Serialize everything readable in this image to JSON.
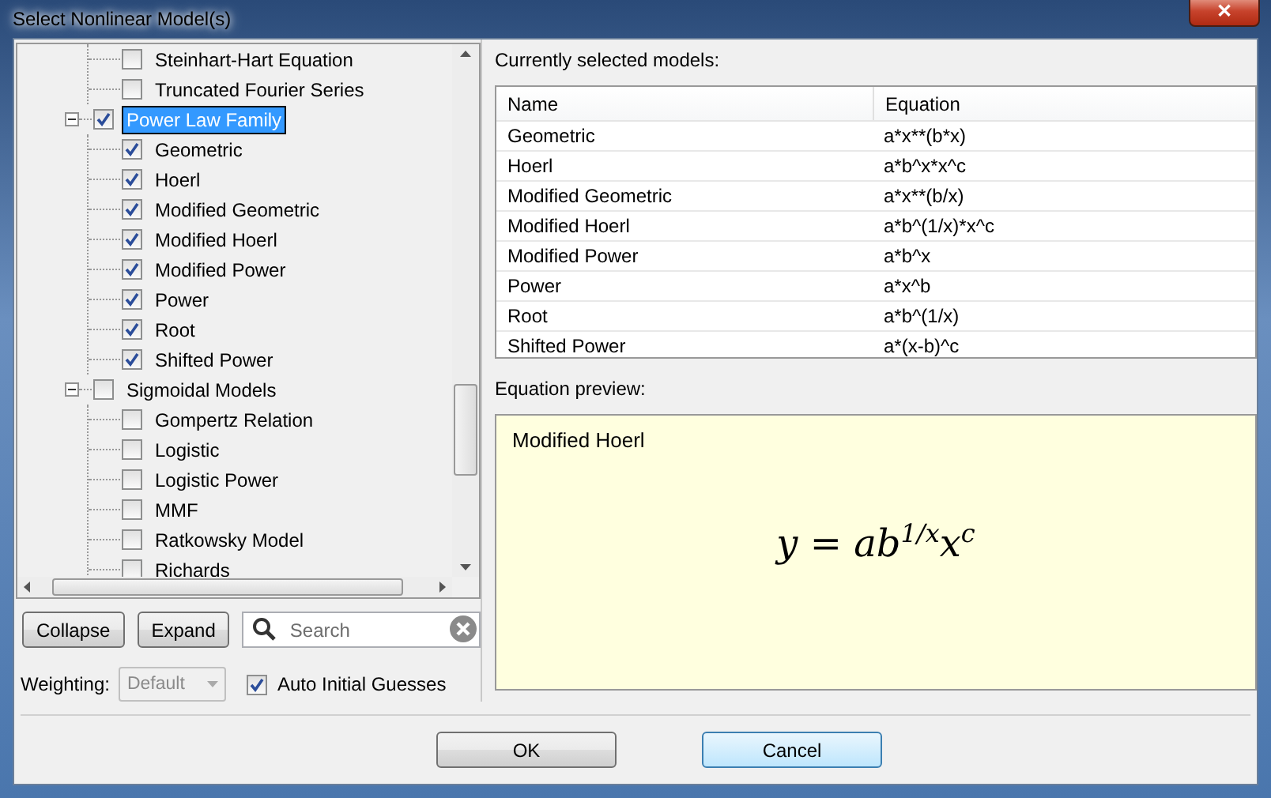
{
  "window": {
    "title": "Select Nonlinear Model(s)",
    "close_label": "✕"
  },
  "tree": {
    "leading_items": [
      {
        "label": "Steinhart-Hart Equation",
        "checked": false
      },
      {
        "label": "Truncated Fourier Series",
        "checked": false
      }
    ],
    "groups": [
      {
        "label": "Power Law Family",
        "checked": true,
        "expanded": true,
        "selected": true,
        "children": [
          {
            "label": "Geometric",
            "checked": true
          },
          {
            "label": "Hoerl",
            "checked": true
          },
          {
            "label": "Modified Geometric",
            "checked": true
          },
          {
            "label": "Modified Hoerl",
            "checked": true
          },
          {
            "label": "Modified Power",
            "checked": true
          },
          {
            "label": "Power",
            "checked": true
          },
          {
            "label": "Root",
            "checked": true
          },
          {
            "label": "Shifted Power",
            "checked": true
          }
        ]
      },
      {
        "label": "Sigmoidal Models",
        "checked": false,
        "expanded": true,
        "selected": false,
        "children": [
          {
            "label": "Gompertz Relation",
            "checked": false
          },
          {
            "label": "Logistic",
            "checked": false
          },
          {
            "label": "Logistic Power",
            "checked": false
          },
          {
            "label": "MMF",
            "checked": false
          },
          {
            "label": "Ratkowsky Model",
            "checked": false
          },
          {
            "label": "Richards",
            "checked": false
          }
        ]
      }
    ]
  },
  "tree_buttons": [
    "Collapse",
    "Expand"
  ],
  "search": {
    "placeholder": "Search"
  },
  "weighting": {
    "label": "Weighting:",
    "value": "Default",
    "disabled": true
  },
  "auto_guesses": {
    "label": "Auto Initial Guesses",
    "checked": true
  },
  "selected_models": {
    "title": "Currently selected models:",
    "columns": [
      "Name",
      "Equation"
    ],
    "rows": [
      [
        "Geometric",
        "a*x**(b*x)"
      ],
      [
        "Hoerl",
        "a*b^x*x^c"
      ],
      [
        "Modified Geometric",
        "a*x**(b/x)"
      ],
      [
        "Modified Hoerl",
        "a*b^(1/x)*x^c"
      ],
      [
        "Modified Power",
        "a*b^x"
      ],
      [
        "Power",
        "a*x^b"
      ],
      [
        "Root",
        "a*b^(1/x)"
      ],
      [
        "Shifted Power",
        "a*(x-b)^c"
      ]
    ]
  },
  "preview": {
    "title": "Equation preview:",
    "model": "Modified Hoerl",
    "equation": "y = ab$^{1/x}$x$^{c}$"
  },
  "buttons": [
    {
      "label": "OK",
      "focused": false
    },
    {
      "label": "Cancel",
      "focused": true
    }
  ]
}
